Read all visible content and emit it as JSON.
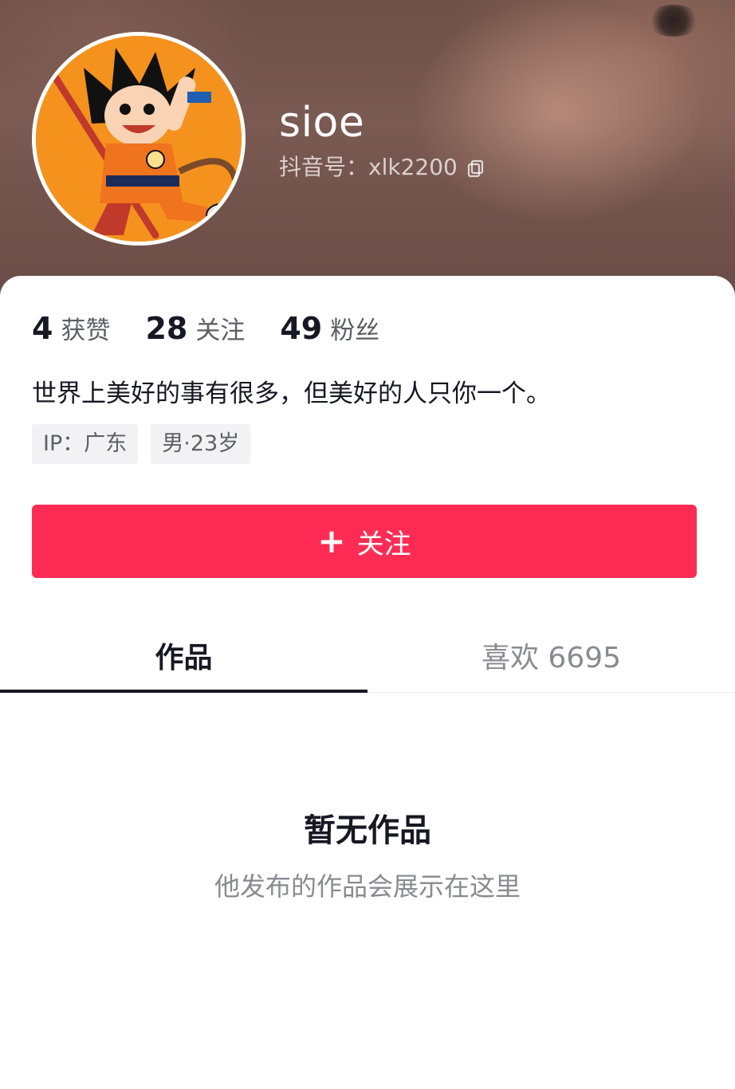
{
  "profile": {
    "username": "sioe",
    "id_label": "抖音号：xlk2200"
  },
  "stats": [
    {
      "value": "4",
      "label": "获赞"
    },
    {
      "value": "28",
      "label": "关注"
    },
    {
      "value": "49",
      "label": "粉丝"
    }
  ],
  "bio": "世界上美好的事有很多，但美好的人只你一个。",
  "tags": [
    "IP：广东",
    "男·23岁"
  ],
  "follow_button": {
    "icon": "+",
    "label": "关注"
  },
  "tabs": [
    {
      "label": "作品",
      "active": true
    },
    {
      "label": "喜欢 6695",
      "active": false
    }
  ],
  "empty_state": {
    "title": "暂无作品",
    "subtitle": "他发布的作品会展示在这里"
  },
  "colors": {
    "accent": "#fe2c55",
    "text_primary": "#161823",
    "text_secondary": "#8a8b91"
  }
}
